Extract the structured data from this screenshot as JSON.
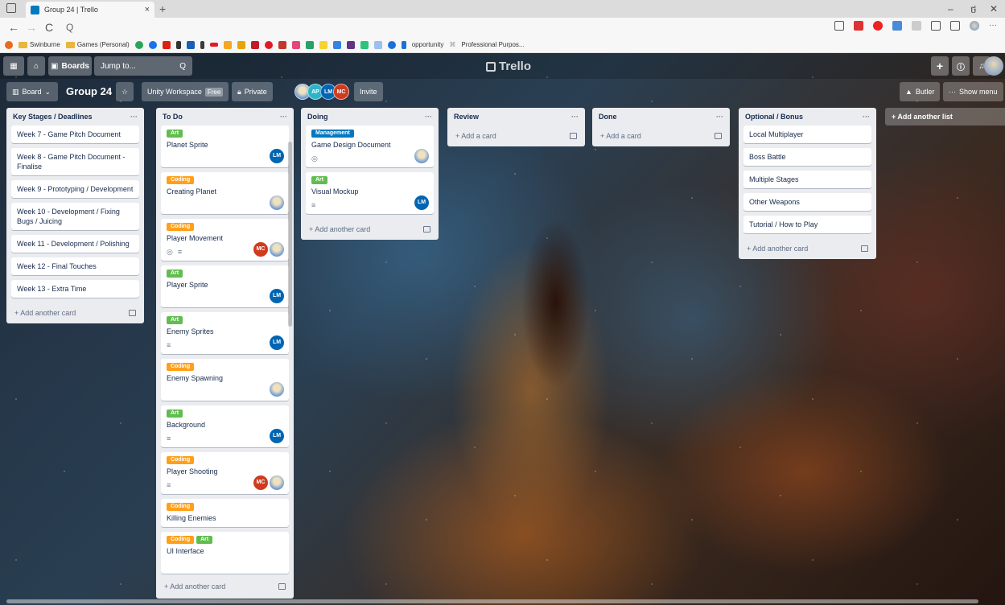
{
  "browser": {
    "tab_title": "Group 24 | Trello",
    "tab_close": "×",
    "new_tab": "+",
    "win_min": "–",
    "win_max": "ថ",
    "win_close": "✕",
    "nav_back": "←",
    "nav_forward": "→",
    "nav_refresh": "C",
    "url_search": "Q",
    "more": "···",
    "bookmarks": [
      {
        "label": "Swinburne",
        "type": "folder"
      },
      {
        "label": "Games (Personal)",
        "type": "folder"
      },
      {
        "label": "opportunity",
        "type": "link"
      },
      {
        "label": "Professional Purpos...",
        "type": "link"
      }
    ]
  },
  "trello_nav": {
    "boards_label": "Boards",
    "search_placeholder": "Jump to...",
    "search_icon": "Q",
    "logo_text": "Trello",
    "create": "+",
    "info": "ⓘ",
    "bell": "♫"
  },
  "board_header": {
    "view_label": "Board",
    "board_name": "Group 24",
    "star": "☆",
    "workspace": "Unity Workspace",
    "workspace_badge": "Free",
    "visibility": "Private",
    "members": [
      {
        "initials": "",
        "color": "photo"
      },
      {
        "initials": "AP",
        "color": "#2bb5c8"
      },
      {
        "initials": "LM",
        "color": "#0065b3"
      },
      {
        "initials": "MC",
        "color": "#cf3b1d"
      }
    ],
    "invite": "Invite",
    "butler": "Butler",
    "show_menu": "Show menu"
  },
  "lists": [
    {
      "title": "Key Stages / Deadlines",
      "add_label": "+ Add another card",
      "cards": [
        {
          "title": "Week 7 - Game Pitch Document"
        },
        {
          "title": "Week 8 - Game Pitch Document - Finalise"
        },
        {
          "title": "Week 9 - Prototyping / Development"
        },
        {
          "title": "Week 10 - Development / Fixing Bugs / Juicing"
        },
        {
          "title": "Week 11 - Development / Polishing"
        },
        {
          "title": "Week 12 - Final Touches"
        },
        {
          "title": "Week 13 - Extra Time"
        }
      ]
    },
    {
      "title": "To Do",
      "add_label": "+ Add another card",
      "cards": [
        {
          "labels": [
            {
              "text": "Art",
              "color": "green"
            }
          ],
          "title": "Planet Sprite",
          "members": [
            "LM"
          ]
        },
        {
          "labels": [
            {
              "text": "Coding",
              "color": "orange"
            }
          ],
          "title": "Creating Planet",
          "members": [
            "photo"
          ]
        },
        {
          "labels": [
            {
              "text": "Coding",
              "color": "orange"
            }
          ],
          "title": "Player Movement",
          "badges": [
            "◎",
            "≡"
          ],
          "members": [
            "MC",
            "photo"
          ]
        },
        {
          "labels": [
            {
              "text": "Art",
              "color": "green"
            }
          ],
          "title": "Player Sprite",
          "members": [
            "LM"
          ]
        },
        {
          "labels": [
            {
              "text": "Art",
              "color": "green"
            }
          ],
          "title": "Enemy Sprites",
          "badges": [
            "≡"
          ],
          "members": [
            "LM"
          ]
        },
        {
          "labels": [
            {
              "text": "Coding",
              "color": "orange"
            }
          ],
          "title": "Enemy Spawning",
          "members": [
            "photo"
          ]
        },
        {
          "labels": [
            {
              "text": "Art",
              "color": "green"
            }
          ],
          "title": "Background",
          "badges": [
            "≡"
          ],
          "members": [
            "LM"
          ]
        },
        {
          "labels": [
            {
              "text": "Coding",
              "color": "orange"
            }
          ],
          "title": "Player Shooting",
          "badges": [
            "≡"
          ],
          "members": [
            "MC",
            "photo"
          ]
        },
        {
          "labels": [
            {
              "text": "Coding",
              "color": "orange"
            }
          ],
          "title": "Killing Enemies"
        },
        {
          "labels": [
            {
              "text": "Coding",
              "color": "orange"
            },
            {
              "text": "Art",
              "color": "green"
            }
          ],
          "title": "UI Interface"
        }
      ]
    },
    {
      "title": "Doing",
      "add_label": "+ Add another card",
      "cards": [
        {
          "labels": [
            {
              "text": "Management",
              "color": "blue"
            }
          ],
          "title": "Game Design Document",
          "badges": [
            "◎"
          ],
          "members": [
            "photo"
          ]
        },
        {
          "labels": [
            {
              "text": "Art",
              "color": "green"
            }
          ],
          "title": "Visual Mockup",
          "badges": [
            "≡"
          ],
          "members": [
            "LM"
          ]
        }
      ]
    },
    {
      "title": "Review",
      "add_label": "+ Add a card",
      "cards": []
    },
    {
      "title": "Done",
      "add_label": "+ Add a card",
      "cards": []
    },
    {
      "title": "Optional / Bonus",
      "add_label": "+ Add another card",
      "cards": [
        {
          "title": "Local Multiplayer"
        },
        {
          "title": "Boss Battle"
        },
        {
          "title": "Multiple Stages"
        },
        {
          "title": "Other Weapons"
        },
        {
          "title": "Tutorial / How to Play"
        }
      ]
    }
  ],
  "add_list_label": "+ Add another list",
  "list_menu": "···",
  "colors": {
    "label_green": "#61bd4f",
    "label_orange": "#ff9f1a",
    "label_blue": "#0079bf",
    "list_bg": "#ebecf0"
  }
}
